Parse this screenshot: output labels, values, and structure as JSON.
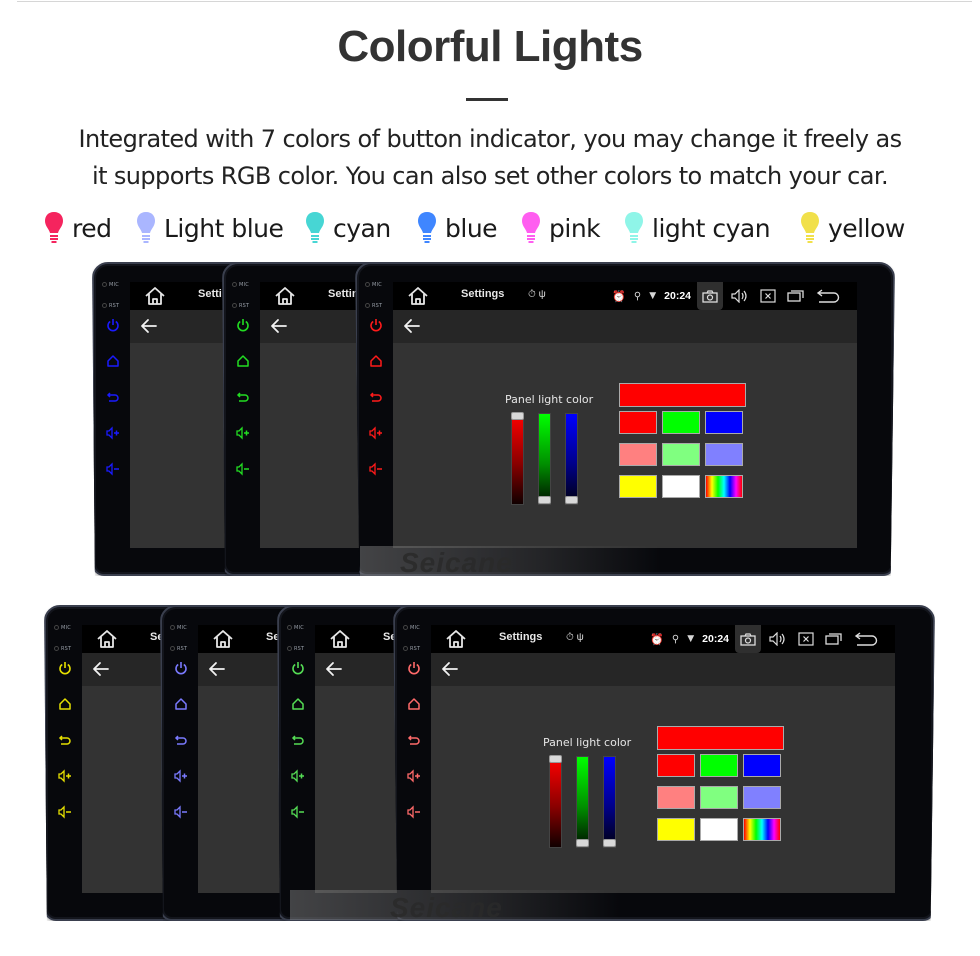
{
  "header": {
    "title": "Colorful Lights",
    "description_line1": "Integrated with 7 colors of button indicator, you may change it freely as",
    "description_line2": "it supports RGB color. You can also set other colors to match your car."
  },
  "legend": [
    {
      "label": "red",
      "color": "#f5245e"
    },
    {
      "label": "Light blue",
      "color": "#aab6ff"
    },
    {
      "label": "cyan",
      "color": "#47d6d4"
    },
    {
      "label": "blue",
      "color": "#3f86ff"
    },
    {
      "label": "pink",
      "color": "#ff5ef0"
    },
    {
      "label": "light cyan",
      "color": "#8ff5e8"
    },
    {
      "label": "yellow",
      "color": "#f1e04a"
    }
  ],
  "device": {
    "side_labels": {
      "mic": "MIC",
      "rst": "RST"
    },
    "side_buttons": [
      "power",
      "home",
      "back",
      "volume-up",
      "volume-down"
    ],
    "side_glyphs": {
      "power": "⏻",
      "home": "⌂",
      "back": "↶",
      "volume-up": "◁+",
      "volume-down": "◁-"
    },
    "screen_title": "Settings",
    "status_icons_left": "⏱ ψ",
    "status_time": "20:24",
    "panel_label": "Panel light color",
    "sliders": [
      {
        "name": "red",
        "level": 1.0
      },
      {
        "name": "green",
        "level": 0.0
      },
      {
        "name": "blue",
        "level": 0.0
      }
    ],
    "preview_color": "#ff0000",
    "swatches": [
      [
        "#ff0000",
        "#00ff00",
        "#0000ff"
      ],
      [
        "#ff8080",
        "#80ff80",
        "#8080ff"
      ],
      [
        "#ffff00",
        "#ffffff",
        "rainbow"
      ]
    ],
    "watermark": "Seicane"
  },
  "top_row_units": [
    {
      "indicator_color": "#1a1aff",
      "label": "blue"
    },
    {
      "indicator_color": "#22dd22",
      "label": "green"
    },
    {
      "indicator_color": "#ff1a1a",
      "label": "red"
    }
  ],
  "bottom_row_units": [
    {
      "indicator_color": "#e6e000",
      "label": "yellow"
    },
    {
      "indicator_color": "#7a7aff",
      "label": "light blue"
    },
    {
      "indicator_color": "#55dd55",
      "label": "light green"
    },
    {
      "indicator_color": "#ff6a6a",
      "label": "light red"
    }
  ]
}
